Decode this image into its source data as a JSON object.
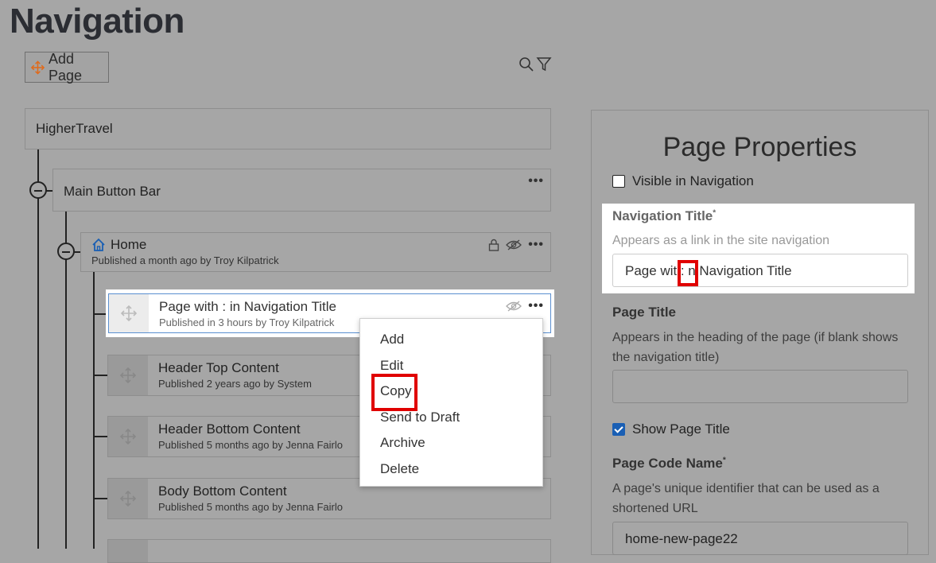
{
  "page": {
    "title": "Navigation"
  },
  "toolbar": {
    "add_page_label": "Add Page"
  },
  "tree": {
    "root": "HigherTravel",
    "main_button_bar": "Main Button Bar",
    "home": {
      "title": "Home",
      "meta": "Published a month ago by Troy Kilpatrick"
    },
    "children": [
      {
        "title": "Page with : in Navigation Title",
        "meta": "Published in 3 hours by Troy Kilpatrick"
      },
      {
        "title": "Header Top Content",
        "meta": "Published 2 years ago by System"
      },
      {
        "title": "Header Bottom Content",
        "meta": "Published 5 months ago by Jenna Fairlo"
      },
      {
        "title": "Body Bottom Content",
        "meta": "Published 5 months ago by Jenna Fairlo"
      }
    ]
  },
  "context_menu": {
    "items": [
      "Add",
      "Edit",
      "Copy",
      "Send to Draft",
      "Archive",
      "Delete"
    ]
  },
  "properties": {
    "heading": "Page Properties",
    "visible_in_nav": "Visible in Navigation",
    "nav_title_label": "Navigation Title",
    "nav_title_help": "Appears as a link in the site navigation",
    "nav_title_value_a": "Page wit",
    "nav_title_value_colon": ":",
    "nav_title_value_b": "n Navigation Title",
    "page_title_label": "Page Title",
    "page_title_help": "Appears in the heading of the page (if blank shows the navigation title)",
    "show_page_title": "Show Page Title",
    "code_name_label": "Page Code Name",
    "code_name_help": "A page's unique identifier that can be used as a shortened URL",
    "code_name_value": "home-new-page22",
    "required_mark": "*"
  },
  "colors": {
    "accent": "#e06a1b",
    "highlight_red": "#e00000",
    "checkbox_blue": "#1a5fb4"
  }
}
